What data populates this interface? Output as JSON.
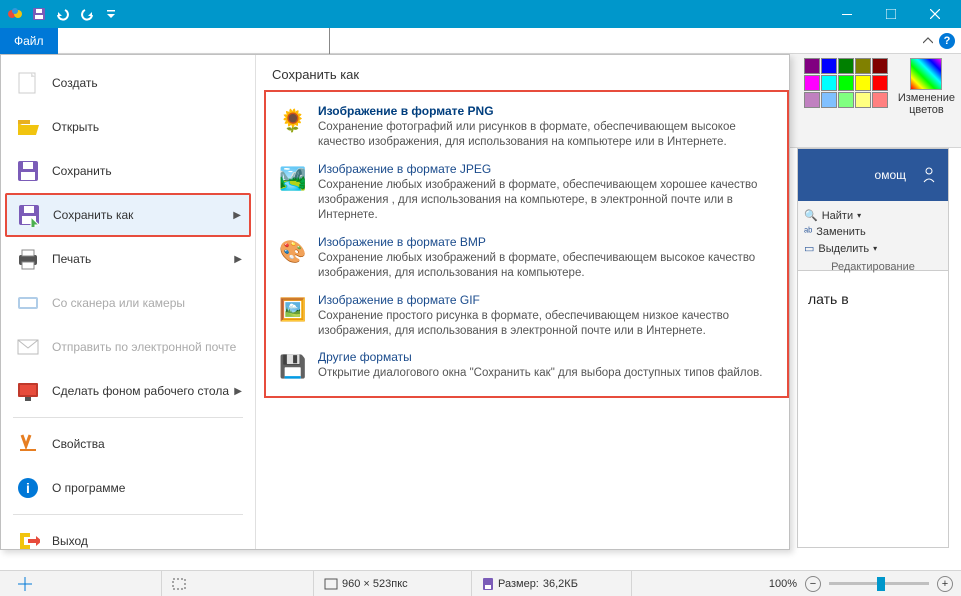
{
  "titlebar": {
    "file_tab": "Файл"
  },
  "ribbon": {
    "edit_colors_l1": "Изменение",
    "edit_colors_l2": "цветов"
  },
  "menu": {
    "items": [
      {
        "label": "Создать",
        "icon": "new"
      },
      {
        "label": "Открыть",
        "icon": "open"
      },
      {
        "label": "Сохранить",
        "icon": "save"
      },
      {
        "label": "Сохранить как",
        "icon": "saveas",
        "selected": true,
        "arrow": true
      },
      {
        "label": "Печать",
        "icon": "print",
        "arrow": true
      },
      {
        "label": "Со сканера или камеры",
        "icon": "scanner",
        "disabled": true
      },
      {
        "label": "Отправить по электронной почте",
        "icon": "email",
        "disabled": true
      },
      {
        "label": "Сделать фоном рабочего стола",
        "icon": "wallpaper",
        "arrow": true
      },
      {
        "label": "Свойства",
        "icon": "props"
      },
      {
        "label": "О программе",
        "icon": "about"
      },
      {
        "label": "Выход",
        "icon": "exit"
      }
    ]
  },
  "submenu": {
    "title": "Сохранить как",
    "items": [
      {
        "title": "Изображение в формате PNG",
        "desc": "Сохранение фотографий или рисунков в формате, обеспечивающем высокое качество изображения, для использования на компьютере или в Интернете.",
        "bold": true
      },
      {
        "title": "Изображение в формате JPEG",
        "desc": "Сохранение любых изображений в формате, обеспечивающем хорошее качество изображения , для использования на компьютере, в электронной почте или в Интернете."
      },
      {
        "title": "Изображение в формате BMP",
        "desc": "Сохранение любых изображений в формате, обеспечивающем высокое качество изображения, для использования на компьютере."
      },
      {
        "title": "Изображение в формате GIF",
        "desc": "Сохранение простого рисунка в формате, обеспечивающем низкое качество изображения, для использования в электронной почте или в Интернете."
      },
      {
        "title": "Другие форматы",
        "desc": "Открытие диалогового окна \"Сохранить как\" для выбора доступных типов файлов."
      }
    ]
  },
  "word": {
    "tab": "омощ",
    "find": "Найти",
    "replace": "Заменить",
    "select": "Выделить",
    "group": "Редактирование",
    "doc_text": "лать в"
  },
  "status": {
    "dims": "960 × 523пкс",
    "size_label": "Размер:",
    "size_val": "36,2КБ",
    "zoom": "100%"
  },
  "colors": [
    "#800080",
    "#0000ff",
    "#008000",
    "#808000",
    "#800000",
    "#ff00ff",
    "#00ffff",
    "#00ff00",
    "#ffff00",
    "#ff0000",
    "#c080c0",
    "#80c0ff",
    "#80ff80",
    "#ffff80",
    "#ff8080"
  ]
}
